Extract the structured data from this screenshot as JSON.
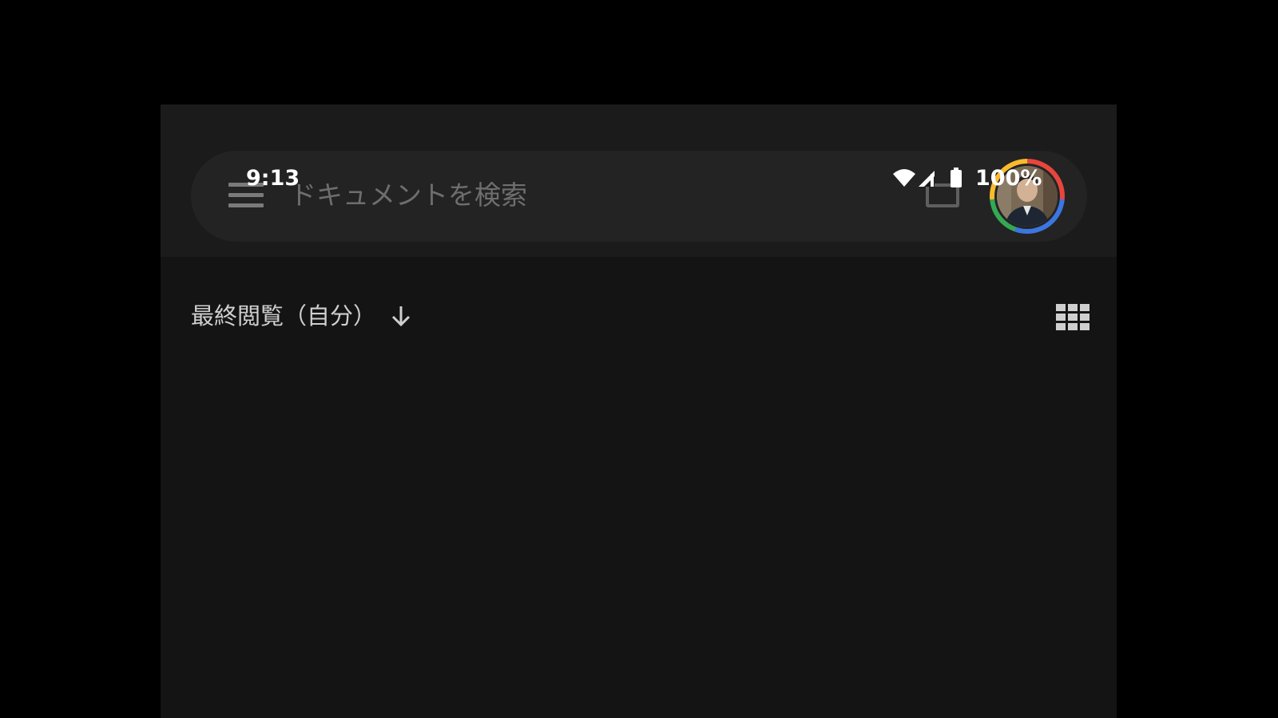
{
  "status_bar": {
    "time": "9:13",
    "battery": "100%",
    "icons": [
      "wifi-icon",
      "signal-icon",
      "battery-icon"
    ]
  },
  "search": {
    "placeholder": "ドキュメントを検索",
    "menu_icon": "menu-icon",
    "view_icon": "view-toggle-icon"
  },
  "sort": {
    "label": "最終閲覧（自分）",
    "arrow_icon": "arrow-down-icon",
    "layout_icon": "grid-view-icon"
  },
  "colors": {
    "background": "#000000",
    "app_background": "#141414",
    "appbar": "#1b1b1b",
    "searchbar": "#232323",
    "placeholder_text": "#6e6e6e",
    "label_text": "#cfcfcf",
    "status_text": "#ffffff"
  }
}
